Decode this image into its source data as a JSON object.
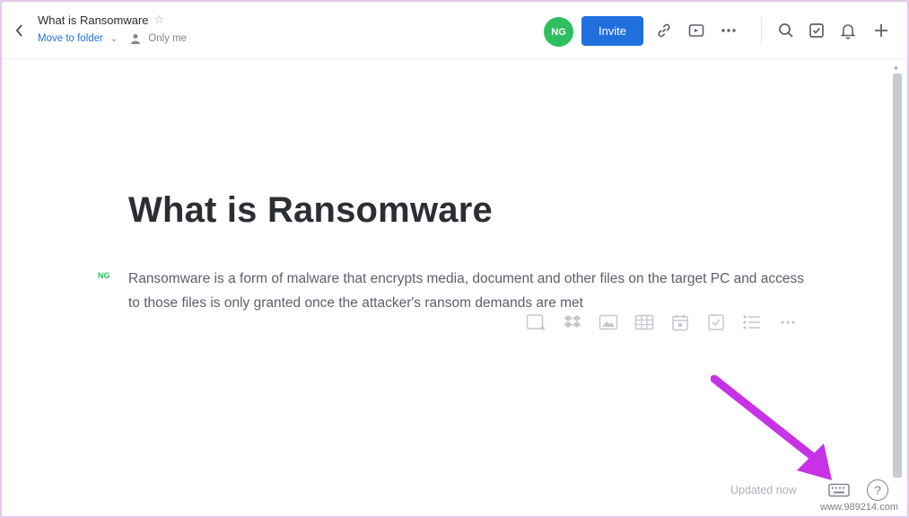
{
  "header": {
    "title": "What is Ransomware",
    "move_to_folder": "Move to folder",
    "sharing": "Only me",
    "avatar_initials": "NG",
    "invite_label": "Invite"
  },
  "document": {
    "heading": "What is Ransomware",
    "author_tag": "NG",
    "paragraph": "Ransomware is a form of malware that encrypts media, document and other files on the target PC and access to those files is only granted once the attacker's ransom demands are met"
  },
  "insert_toolbar": {
    "icons": [
      "add-media-icon",
      "dropbox-icon",
      "image-icon",
      "table-icon",
      "calendar-icon",
      "checkbox-icon",
      "list-icon",
      "more-icon"
    ]
  },
  "footer": {
    "status": "Updated now",
    "help": "?"
  },
  "watermark": "www.989214.com",
  "colors": {
    "accent": "#1f6fde",
    "avatar": "#2ebf5e",
    "annotation_arrow": "#c832e6"
  }
}
